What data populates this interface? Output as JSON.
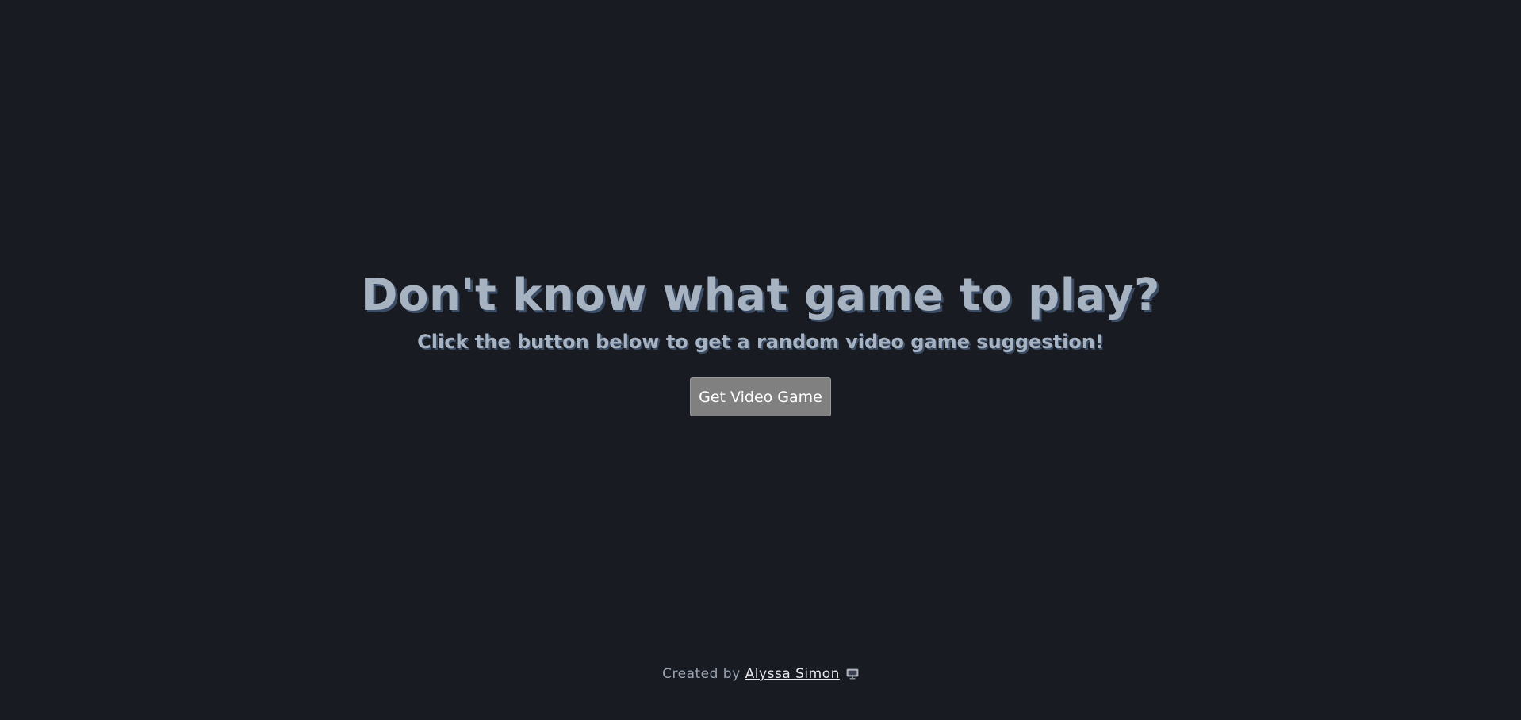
{
  "hero": {
    "title": "Don't know what game to play?",
    "subtitle": "Click the button below to get a random video game suggestion!",
    "button_label": "Get Video Game"
  },
  "footer": {
    "prefix": "Created by",
    "author": "Alyssa Simon",
    "icon": "monitor-icon"
  },
  "colors": {
    "background": "#181b22",
    "heading": "#a7b3c1",
    "heading_shadow": "#3a4c66",
    "button": "#808080"
  }
}
